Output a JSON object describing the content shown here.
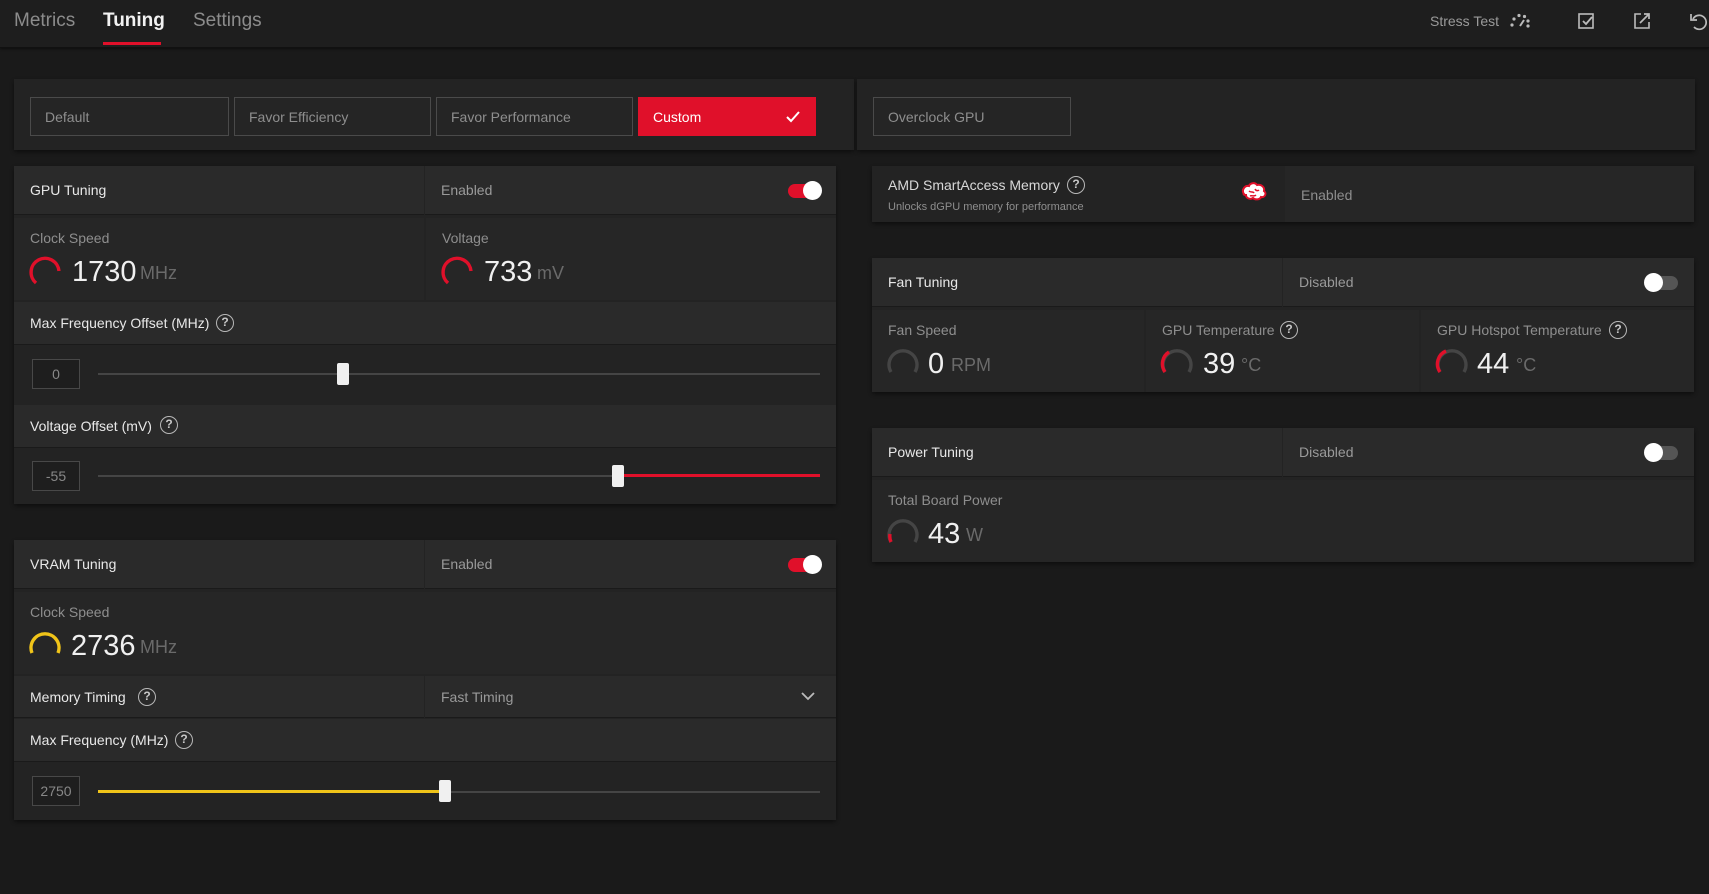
{
  "tabs": {
    "metrics": "Metrics",
    "tuning": "Tuning",
    "settings": "Settings"
  },
  "toolbar": {
    "stress_test": "Stress Test"
  },
  "presets": {
    "default": "Default",
    "efficiency": "Favor Efficiency",
    "performance": "Favor Performance",
    "custom": "Custom",
    "overclock": "Overclock GPU"
  },
  "gpu": {
    "title": "GPU Tuning",
    "state": "Enabled",
    "clock_label": "Clock Speed",
    "clock_value": "1730",
    "clock_unit": "MHz",
    "voltage_label": "Voltage",
    "voltage_value": "733",
    "voltage_unit": "mV",
    "maxfreq_label": "Max Frequency Offset (MHz)",
    "maxfreq_value": "0",
    "maxfreq_level": 0.34,
    "voltoff_label": "Voltage Offset (mV)",
    "voltoff_value": "-55",
    "voltoff_level": 0.72
  },
  "vram": {
    "title": "VRAM Tuning",
    "state": "Enabled",
    "clock_label": "Clock Speed",
    "clock_value": "2736",
    "clock_unit": "MHz",
    "timing_label": "Memory Timing",
    "timing_value": "Fast Timing",
    "maxfreq_label": "Max Frequency (MHz)",
    "maxfreq_value": "2750",
    "maxfreq_level": 0.48
  },
  "sam": {
    "title": "AMD SmartAccess Memory",
    "desc": "Unlocks dGPU memory for performance",
    "state": "Enabled"
  },
  "fan": {
    "title": "Fan Tuning",
    "state": "Disabled",
    "speed_label": "Fan Speed",
    "speed_value": "0",
    "speed_unit": "RPM",
    "temp_label": "GPU Temperature",
    "temp_value": "39",
    "temp_unit": "°C",
    "hotspot_label": "GPU Hotspot Temperature",
    "hotspot_value": "44",
    "hotspot_unit": "°C"
  },
  "power": {
    "title": "Power Tuning",
    "state": "Disabled",
    "tbp_label": "Total Board Power",
    "tbp_value": "43",
    "tbp_unit": "W"
  },
  "colors": {
    "accent": "#e0102a",
    "vram": "#f0c419",
    "gauge_track": "#454545"
  }
}
